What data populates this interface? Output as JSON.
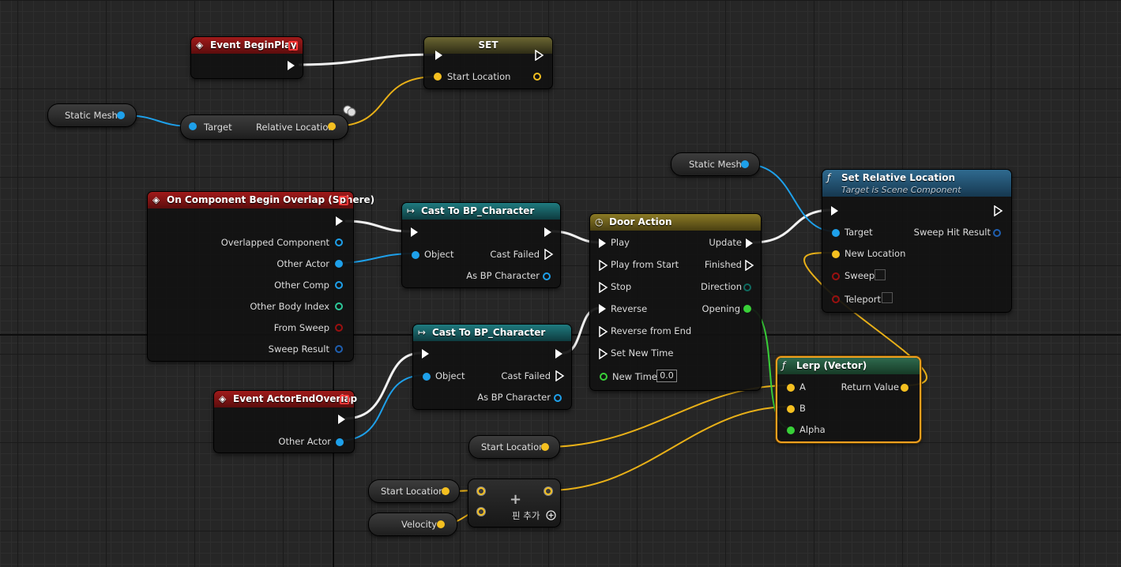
{
  "nodes": {
    "begin_play": {
      "title": "Event BeginPlay"
    },
    "set": {
      "title": "SET",
      "pin_start_location": "Start Location"
    },
    "static_mesh_1": {
      "label": "Static Mesh"
    },
    "get_rel_loc": {
      "pin_target": "Target",
      "pin_relative_location": "Relative Location"
    },
    "overlap": {
      "title": "On Component Begin Overlap (Sphere)",
      "pins": [
        "Overlapped Component",
        "Other Actor",
        "Other Comp",
        "Other Body Index",
        "From Sweep",
        "Sweep Result"
      ]
    },
    "cast1": {
      "title": "Cast To BP_Character",
      "pin_object": "Object",
      "pin_cast_failed": "Cast Failed",
      "pin_as": "As BP Character"
    },
    "cast2": {
      "title": "Cast To BP_Character",
      "pin_object": "Object",
      "pin_cast_failed": "Cast Failed",
      "pin_as": "As BP Character"
    },
    "end_overlap": {
      "title": "Event ActorEndOverlap",
      "pin_other_actor": "Other Actor"
    },
    "door_action": {
      "title": "Door Action",
      "inputs": [
        "Play",
        "Play from Start",
        "Stop",
        "Reverse",
        "Reverse from End",
        "Set New Time"
      ],
      "outputs": [
        "Update",
        "Finished",
        "Direction",
        "Opening"
      ],
      "new_time_label": "New Time",
      "new_time_value": "0.0"
    },
    "static_mesh_2": {
      "label": "Static Mesh"
    },
    "set_rel_loc": {
      "title": "Set Relative Location",
      "subtitle": "Target is Scene Component",
      "pin_target": "Target",
      "pin_new_location": "New Location",
      "pin_sweep": "Sweep",
      "pin_teleport": "Teleport",
      "pin_sweep_hit_result": "Sweep Hit Result"
    },
    "lerp": {
      "title": "Lerp (Vector)",
      "pin_a": "A",
      "pin_b": "B",
      "pin_alpha": "Alpha",
      "pin_return": "Return Value"
    },
    "start_location_1": {
      "label": "Start Location"
    },
    "start_location_2": {
      "label": "Start Location"
    },
    "velocity": {
      "label": "Velocity"
    },
    "add": {
      "symbol": "+",
      "add_pin_label": "핀 추가"
    }
  },
  "colors": {
    "exec": "#ffffff",
    "object": "#1ea0ea",
    "vector": "#f5c020",
    "float": "#38d038",
    "int": "#2ec89a",
    "bool": "#9a1010",
    "struct": "#1f5fb0"
  },
  "icons": {
    "event": "event-diamond-icon",
    "cast": "cast-arrow-icon",
    "timeline": "clock-icon",
    "function": "function-f-icon",
    "add_pin": "plus-circle-icon"
  }
}
